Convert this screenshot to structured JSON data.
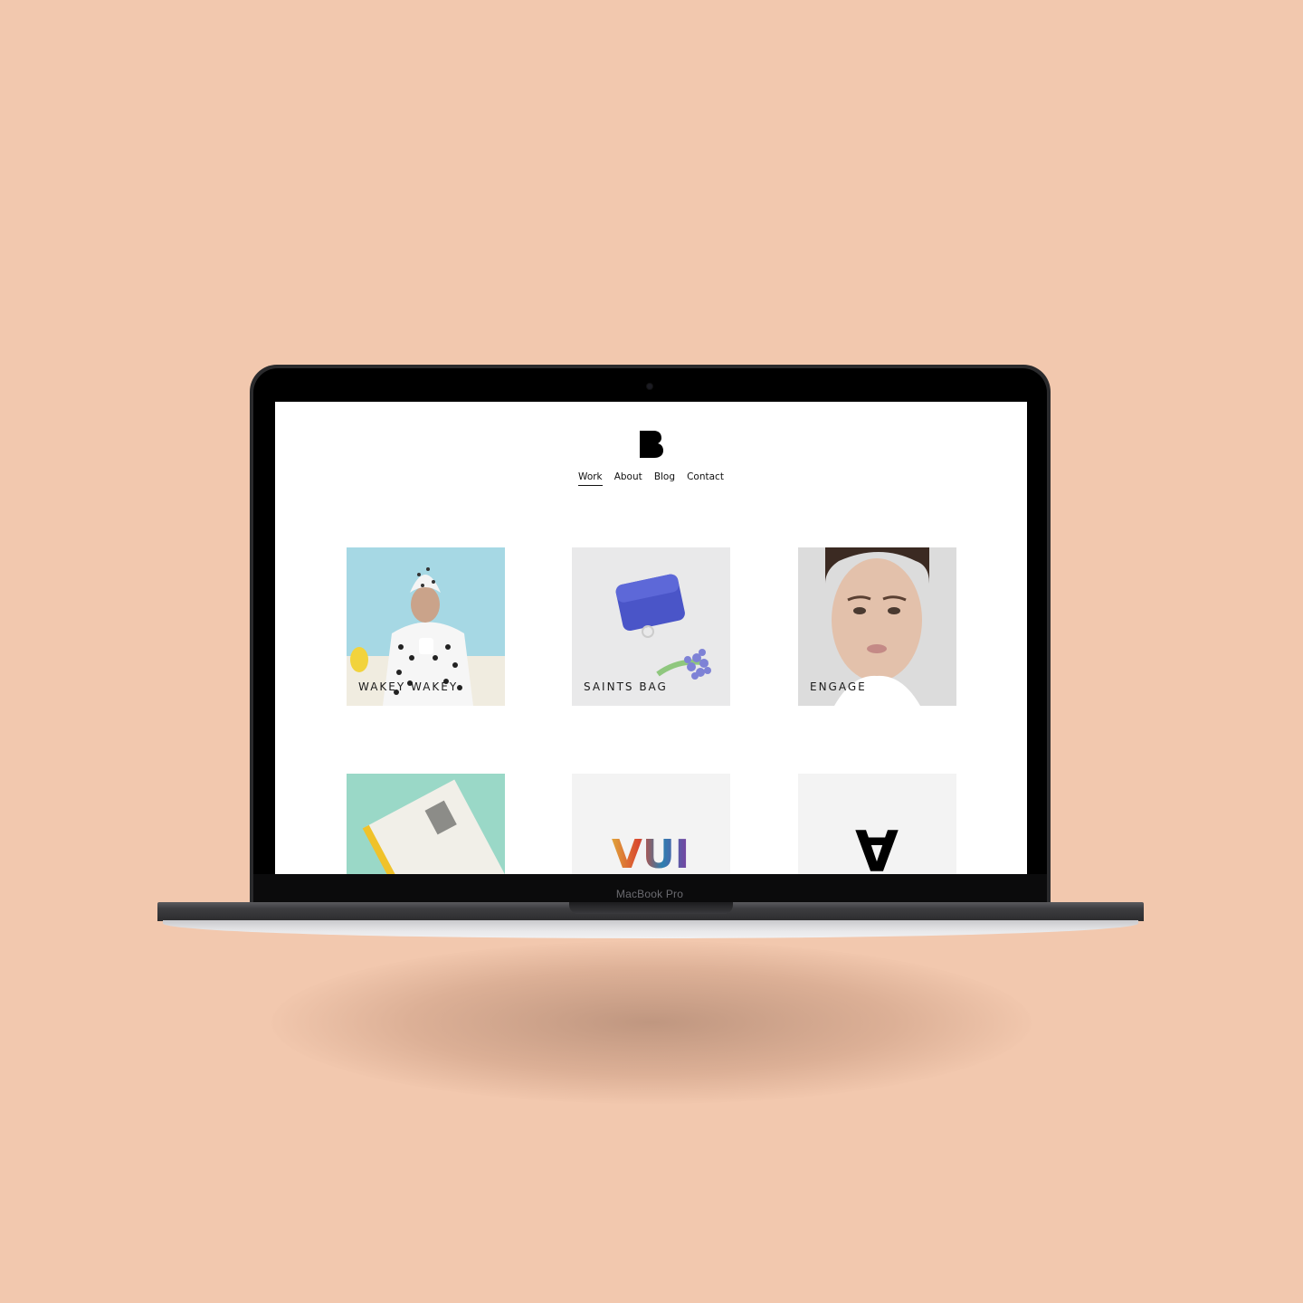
{
  "device": {
    "label": "MacBook Pro"
  },
  "site": {
    "logo": "B",
    "nav": [
      "Work",
      "About",
      "Blog",
      "Contact"
    ]
  },
  "projects": [
    {
      "caption": "WAKEY WAKEY"
    },
    {
      "caption": "SAINTS BAG"
    },
    {
      "caption": "ENGAGE"
    },
    {
      "caption": ""
    },
    {
      "caption": "",
      "artwork_text": "VUI"
    },
    {
      "caption": "",
      "artwork_text": "A"
    }
  ],
  "colors": {
    "background": "#f2c8ae",
    "screen": "#ffffff",
    "text": "#111111"
  }
}
